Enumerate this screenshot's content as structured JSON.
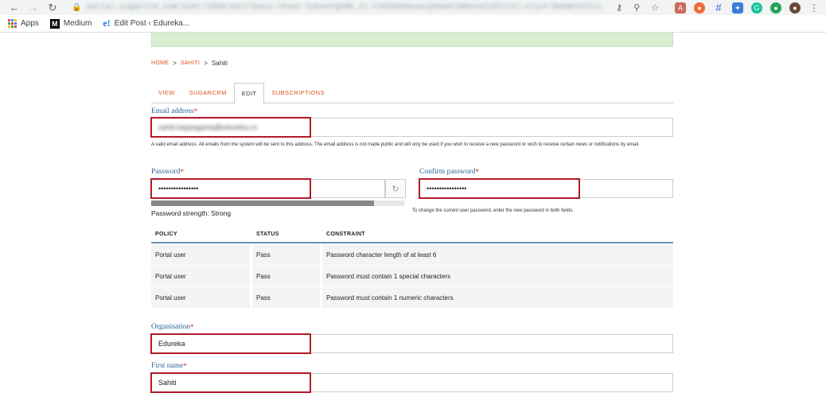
{
  "browser": {
    "url": "portal.sugarcrm.com/user/1568/edit?pass-reset-token=QkMX_zl-tvRZDOVboowJpHwOnlmbonsCvbfnlhl-UlyvrlN4dmfXrhlL",
    "bookmarks": [
      {
        "label": "Apps"
      },
      {
        "label": "Medium"
      },
      {
        "label": "Edit Post ‹ Edureka..."
      }
    ]
  },
  "breadcrumb": {
    "home": "HOME",
    "sep1": ">",
    "parent": "SAHITI",
    "sep2": ">",
    "current": "Sahiti"
  },
  "tabs": [
    {
      "label": "VIEW"
    },
    {
      "label": "SUGARCRM"
    },
    {
      "label": "EDIT"
    },
    {
      "label": "SUBSCRIPTIONS"
    }
  ],
  "email": {
    "label": "Email address",
    "required": "*",
    "value": "sahiti.kappaganta@edureka.co",
    "help": "A valid email address. All emails from the system will be sent to this address. The email address is not made public and will only be used if you wish to receive a new password or wish to receive certain news or notifications by email."
  },
  "password": {
    "label": "Password",
    "required": "*",
    "value": "••••••••••••••••",
    "strength_fraction": 0.88,
    "strength_text": "Password strength: Strong"
  },
  "confirm_password": {
    "label": "Confirm password",
    "required": "*",
    "value": "••••••••••••••••",
    "help": "To change the current user password, enter the new password in both fields."
  },
  "policy_table": {
    "headers": [
      "POLICY",
      "STATUS",
      "CONSTRAINT"
    ],
    "rows": [
      [
        "Portal user",
        "Pass",
        "Password character length of at least 6"
      ],
      [
        "Portal user",
        "Pass",
        "Password must contain 1 special characters"
      ],
      [
        "Portal user",
        "Pass",
        "Password must contain 1 numeric characters"
      ]
    ]
  },
  "organisation": {
    "label": "Organisation",
    "required": "*",
    "value": "Edureka"
  },
  "first_name": {
    "label": "First name",
    "required": "*",
    "value": "Sahiti"
  },
  "colors": {
    "accent_link": "#e0511c",
    "label_blue": "#2a6496",
    "highlight_red": "#b11a28",
    "banner_green": "#d8eed0"
  }
}
